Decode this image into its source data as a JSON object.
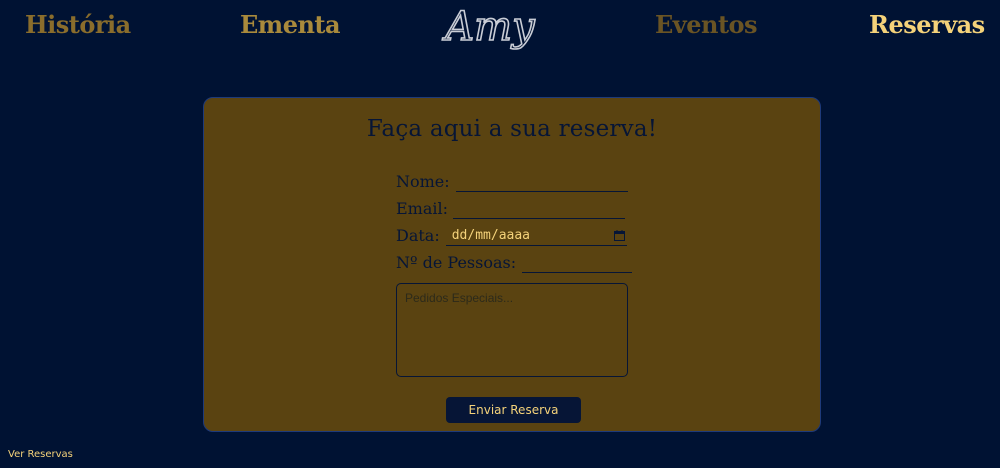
{
  "nav": {
    "historia": "História",
    "ementa": "Ementa",
    "eventos": "Eventos",
    "reservas": "Reservas"
  },
  "logo": {
    "text": "Amy"
  },
  "form": {
    "title": "Faça aqui a sua reserva!",
    "nome_label": "Nome:",
    "email_label": "Email:",
    "data_label": "Data:",
    "data_placeholder": "dd/mm/aaaa",
    "pessoas_label": "Nº de Pessoas:",
    "pedidos_placeholder": "Pedidos Especiais...",
    "submit_label": "Enviar Reserva"
  },
  "footer": {
    "ver_reservas": "Ver Reservas"
  },
  "colors": {
    "background": "#001233",
    "card": "#5a4311",
    "accent": "#f4d27a",
    "text_dark": "#061536"
  }
}
